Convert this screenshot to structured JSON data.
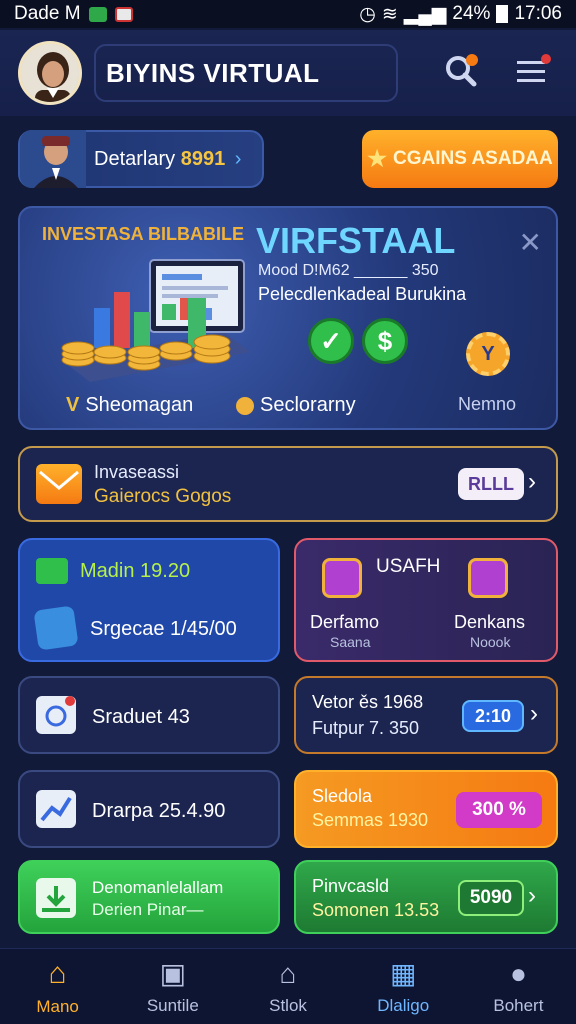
{
  "status_bar": {
    "left_text": "Dade M",
    "battery": "24%",
    "time": "17:06"
  },
  "header": {
    "title": "BIYINS VIRTUAL"
  },
  "promo": {
    "label": "Detarlary",
    "value": "8991",
    "arrow": "›"
  },
  "orange_button": {
    "label": "CGAINS ASADAA"
  },
  "banner": {
    "eyebrow": "INVESTASA BILBABILE",
    "title": "VIRFSTAAL",
    "line1": "Mood D!M62 ______ 350",
    "line2": "Pelecdlenkadeal Burukina",
    "foot1": "Sheomagan",
    "foot1_prefix": "V",
    "foot2": "Seclorarny",
    "foot3": "Nemno"
  },
  "invest_row": {
    "line1": "Invaseassi",
    "line2": "Gaierocs Gogos",
    "button": "RLLL"
  },
  "tile_blue": {
    "row1": "Madin 19.20",
    "row2": "Srgecae 1/45/00"
  },
  "tile_red": {
    "title": "USAFH",
    "item1_title": "Derfamo",
    "item1_sub": "Saana",
    "item2_title": "Denkans",
    "item2_sub": "Noook"
  },
  "tile_graduet": {
    "label": "Sraduet 43"
  },
  "tile_veto": {
    "line1": "Vetor ěs 1968",
    "line2": "Futpur 7. 350",
    "pill": "2:10"
  },
  "tile_drarpa": {
    "label": "Drarpa 25.4.90"
  },
  "tile_orange": {
    "line1": "Sledola",
    "line2": "Semmas 1930",
    "pill": "300 %"
  },
  "tile_green1": {
    "line1": "Denomanlelallam",
    "line2": "Derien Pinar—"
  },
  "tile_green2": {
    "line1": "Pinvcasld",
    "line2": "Somonen 13.53",
    "pill": "5090"
  },
  "nav": {
    "items": [
      "Mano",
      "Suntile",
      "Stlok",
      "Dlaligo",
      "Bohert"
    ]
  },
  "colors": {
    "bg": "#121a3a",
    "accent": "#ffb12b",
    "cyan": "#6fd6ff",
    "green": "#2fbf4a"
  }
}
